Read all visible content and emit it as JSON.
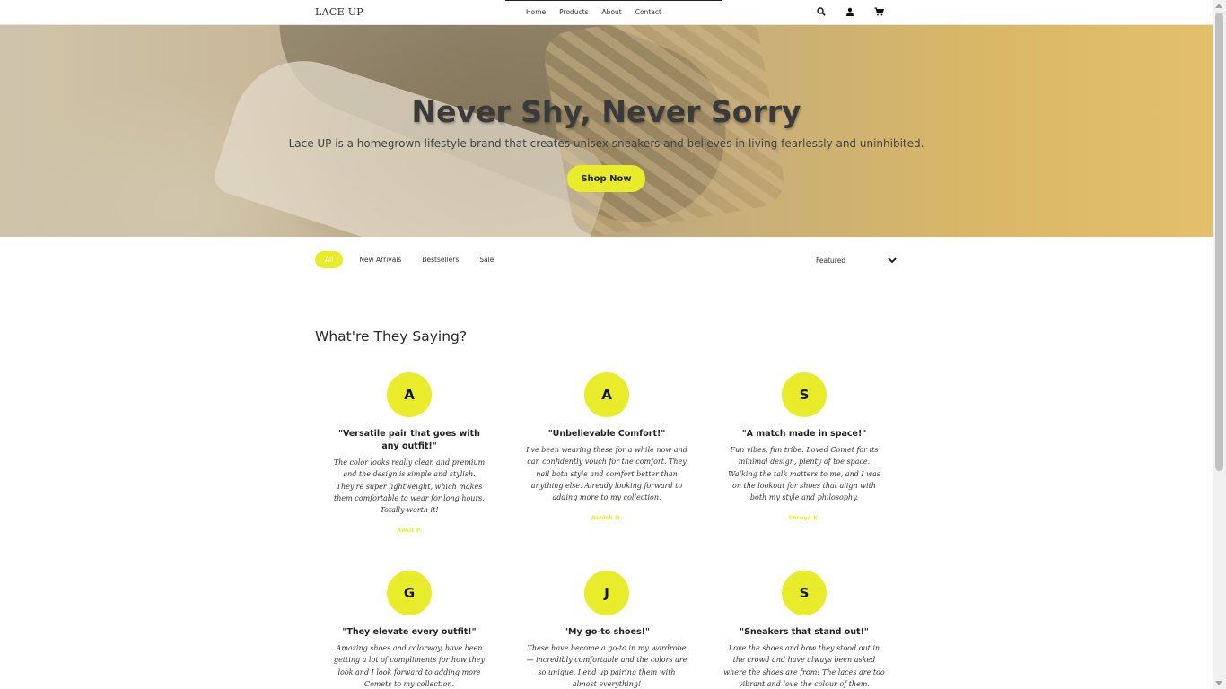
{
  "header": {
    "logo": "LACE UP",
    "nav": [
      "Home",
      "Products",
      "About",
      "Contact"
    ],
    "icons": [
      "search-icon",
      "user-icon",
      "cart-icon"
    ]
  },
  "hero": {
    "title": "Never Shy, Never Sorry",
    "subtitle": "Lace UP is a homegrown lifestyle brand that creates unisex sneakers and believes in living fearlessly and uninhibited.",
    "cta": "Shop Now"
  },
  "filters": {
    "chips": [
      "All",
      "New Arrivals",
      "Bestsellers",
      "Sale"
    ],
    "active": "All",
    "sort_selected": "Featured"
  },
  "testimonials": {
    "title": "What're They Saying?",
    "items": [
      {
        "initial": "A",
        "heading": "\"Versatile pair that goes with any outfit!\"",
        "body": "The color looks really clean and premium and the design is simple and stylish. They're super lightweight, which makes them comfortable to wear for long hours. Totally worth it!",
        "author": "Ankit P."
      },
      {
        "initial": "A",
        "heading": "\"Unbelievable Comfort!\"",
        "body": "I've been wearing these for a while now and can confidently vouch for the comfort. They nail both style and comfort better than anything else. Already looking forward to adding more to my collection.",
        "author": "Ashish D."
      },
      {
        "initial": "S",
        "heading": "\"A match made in space!\"",
        "body": "Fun vibes, fun tribe. Loved Comet for its minimal design, plenty of toe space. Walking the talk matters to me, and I was on the lookout for shoes that align with both my style and philosophy.",
        "author": "Shreya K."
      },
      {
        "initial": "G",
        "heading": "\"They elevate every outfit!\"",
        "body": "Amazing shoes and colorway, have been getting a lot of compliments for how they look and I look forward to adding more Comets to my collection.",
        "author": ""
      },
      {
        "initial": "J",
        "heading": "\"My go-to shoes!\"",
        "body": "These have become a go-to in my wardrobe — incredibly comfortable and the colors are so unique. I end up pairing them with almost everything!",
        "author": ""
      },
      {
        "initial": "S",
        "heading": "\"Sneakers that stand out!\"",
        "body": "Love the shoes and how they stood out in the crowd and have always been asked where the shoes are from! The laces are too vibrant and love the colour of them.",
        "author": ""
      }
    ]
  },
  "colors": {
    "accent": "#e8ec2a",
    "text": "#222222"
  }
}
